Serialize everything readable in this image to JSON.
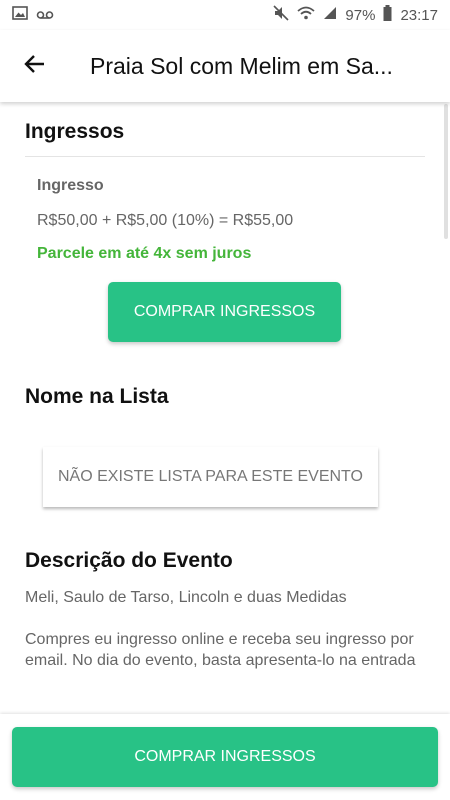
{
  "status_bar": {
    "battery": "97%",
    "time": "23:17"
  },
  "appbar": {
    "title": "Praia Sol com Melim em Sa..."
  },
  "tickets": {
    "heading": "Ingressos",
    "ticket_name": "Ingresso",
    "price_line": "R$50,00 + R$5,00 (10%) = R$55,00",
    "installments": "Parcele em até 4x sem juros",
    "buy_button": "COMPRAR INGRESSOS"
  },
  "guest_list": {
    "heading": "Nome na Lista",
    "empty_message": "NÃO EXISTE LISTA PARA ESTE EVENTO"
  },
  "description": {
    "heading": "Descrição do Evento",
    "artists": "Meli, Saulo de Tarso, Lincoln e duas Medidas",
    "text": "Compres eu ingresso online e receba seu ingresso por email. No dia do evento, basta apresenta-lo na entrada"
  },
  "bottom": {
    "buy_button": "COMPRAR INGRESSOS"
  },
  "colors": {
    "accent": "#28c286",
    "installments": "#44b53a"
  }
}
